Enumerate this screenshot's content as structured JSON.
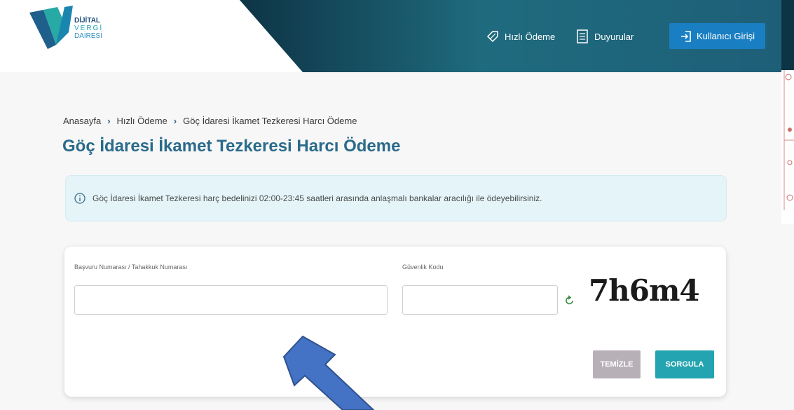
{
  "header": {
    "logo_lines": [
      "DİJİTAL",
      "VERGİ",
      "DAİRESİ"
    ],
    "nav_fast_payment": "Hızlı Ödeme",
    "nav_announcements": "Duyurular",
    "login_button": "Kullanıcı Girişi"
  },
  "breadcrumb": {
    "home": "Anasayfa",
    "fast_payment": "Hızlı Ödeme",
    "current": "Göç İdaresi İkamet Tezkeresi Harcı Ödeme"
  },
  "page_title": "Göç İdaresi İkamet Tezkeresi Harcı Ödeme",
  "info_text": "Göç İdaresi İkamet Tezkeresi harç bedelinizi 02:00-23:45 saatleri arasında anlaşmalı bankalar aracılığı ile ödeyebilirsiniz.",
  "form": {
    "application_label": "Başvuru Numarası / Tahakkuk Numarası",
    "application_value": "",
    "security_label": "Güvenlik Kodu",
    "security_value": "",
    "captcha_text": "7h6m4",
    "clear_button": "TEMİZLE",
    "query_button": "SORGULA"
  },
  "colors": {
    "teal_header": "#1f6b7e",
    "dark_band": "#0c2f3f",
    "login_blue": "#1a7fc2",
    "title_blue": "#2a6a8b",
    "query_teal": "#24a4b0",
    "clear_gray": "#b7b0b7",
    "arrow_blue": "#4472c4"
  },
  "icons": [
    "logo-icon",
    "tag-icon",
    "document-icon",
    "login-icon",
    "info-icon",
    "refresh-icon",
    "arrow-annotation"
  ]
}
